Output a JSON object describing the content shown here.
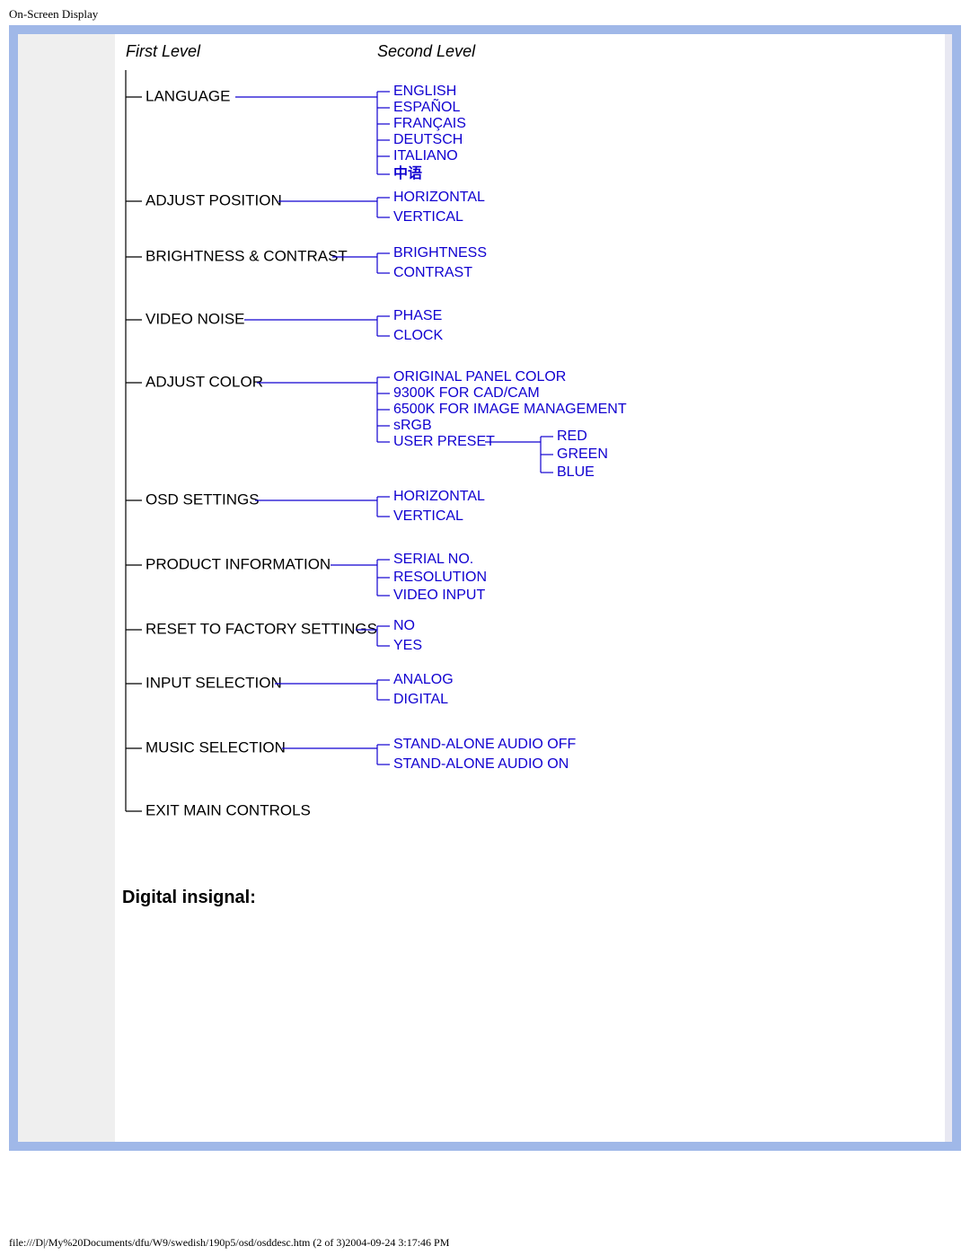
{
  "document_title": "On-Screen Display",
  "headers": {
    "first": "First Level",
    "second": "Second Level"
  },
  "tree": {
    "language": {
      "label": "LANGUAGE",
      "children": [
        "ENGLISH",
        "ESPAÑOL",
        "FRANÇAIS",
        "DEUTSCH",
        "ITALIANO",
        "中语"
      ]
    },
    "adjust_position": {
      "label": "ADJUST POSITION",
      "children": [
        "HORIZONTAL",
        "VERTICAL"
      ]
    },
    "brightness_contrast": {
      "label": "BRIGHTNESS & CONTRAST",
      "children": [
        "BRIGHTNESS",
        "CONTRAST"
      ]
    },
    "video_noise": {
      "label": "VIDEO NOISE",
      "children": [
        "PHASE",
        "CLOCK"
      ]
    },
    "adjust_color": {
      "label": "ADJUST COLOR",
      "children": [
        "ORIGINAL PANEL COLOR",
        "9300K FOR CAD/CAM",
        "6500K FOR IMAGE MANAGEMENT",
        "sRGB",
        "USER PRESET"
      ],
      "user_preset_children": [
        "RED",
        "GREEN",
        "BLUE"
      ]
    },
    "osd_settings": {
      "label": "OSD SETTINGS",
      "children": [
        "HORIZONTAL",
        "VERTICAL"
      ]
    },
    "product_information": {
      "label": "PRODUCT INFORMATION",
      "children": [
        "SERIAL NO.",
        "RESOLUTION",
        "VIDEO INPUT"
      ]
    },
    "reset": {
      "label": "RESET TO FACTORY SETTINGS",
      "children": [
        "NO",
        "YES"
      ]
    },
    "input_selection": {
      "label": "INPUT SELECTION",
      "children": [
        "ANALOG",
        "DIGITAL"
      ]
    },
    "music_selection": {
      "label": "MUSIC SELECTION",
      "children": [
        "STAND-ALONE AUDIO OFF",
        "STAND-ALONE AUDIO ON"
      ]
    },
    "exit": {
      "label": "EXIT MAIN CONTROLS"
    }
  },
  "subheading": "Digital insignal:",
  "footer": "file:///D|/My%20Documents/dfu/W9/swedish/190p5/osd/osddesc.htm (2 of 3)2004-09-24 3:17:46 PM"
}
